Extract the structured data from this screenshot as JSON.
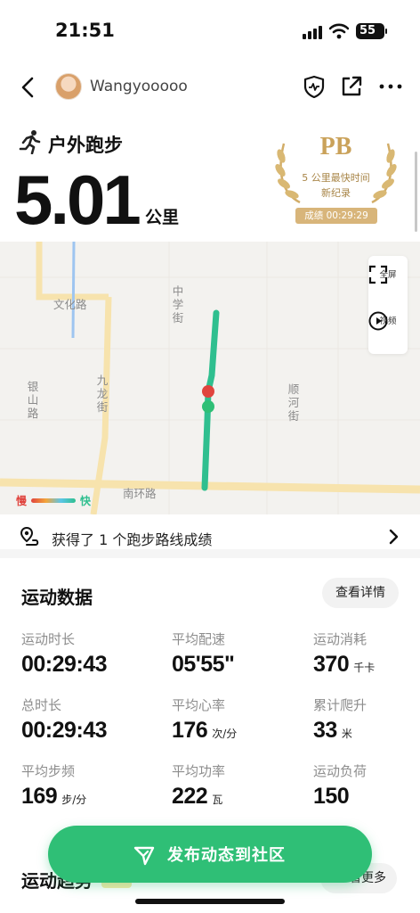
{
  "status_bar": {
    "time": "21:51",
    "battery": "55"
  },
  "nav": {
    "username": "Wangyooooo"
  },
  "activity": {
    "type": "户外跑步",
    "distance": "5.01",
    "distance_unit": "公里"
  },
  "pb": {
    "title": "PB",
    "line1": "5 公里最快时间",
    "line2": "新纪录",
    "result": "成绩 00:29:29"
  },
  "map": {
    "roads": [
      "文化路",
      "中学街",
      "银山路",
      "九龙街",
      "顺河街",
      "南环路"
    ],
    "tools": {
      "fullscreen": "全屏",
      "video": "视频"
    },
    "legend": {
      "slow": "慢",
      "fast": "快"
    }
  },
  "route": {
    "text": "获得了 1 个跑步路线成绩"
  },
  "stats": {
    "title": "运动数据",
    "detail_button": "查看详情",
    "metrics": [
      {
        "label": "运动时长",
        "value": "00:29:43",
        "unit": ""
      },
      {
        "label": "平均配速",
        "value": "05'55\"",
        "unit": ""
      },
      {
        "label": "运动消耗",
        "value": "370",
        "unit": "千卡"
      },
      {
        "label": "总时长",
        "value": "00:29:43",
        "unit": ""
      },
      {
        "label": "平均心率",
        "value": "176",
        "unit": "次/分"
      },
      {
        "label": "累计爬升",
        "value": "33",
        "unit": "米"
      },
      {
        "label": "平均步频",
        "value": "169",
        "unit": "步/分"
      },
      {
        "label": "平均功率",
        "value": "222",
        "unit": "瓦"
      },
      {
        "label": "运动负荷",
        "value": "150",
        "unit": ""
      }
    ]
  },
  "trend": {
    "title": "运动趋势",
    "more_button": "查看更多"
  },
  "publish": {
    "label": "发布动态到社区"
  },
  "colors": {
    "accent": "#2fbf76",
    "route": "#2fbf8f",
    "pb_gold": "#caa25a"
  }
}
